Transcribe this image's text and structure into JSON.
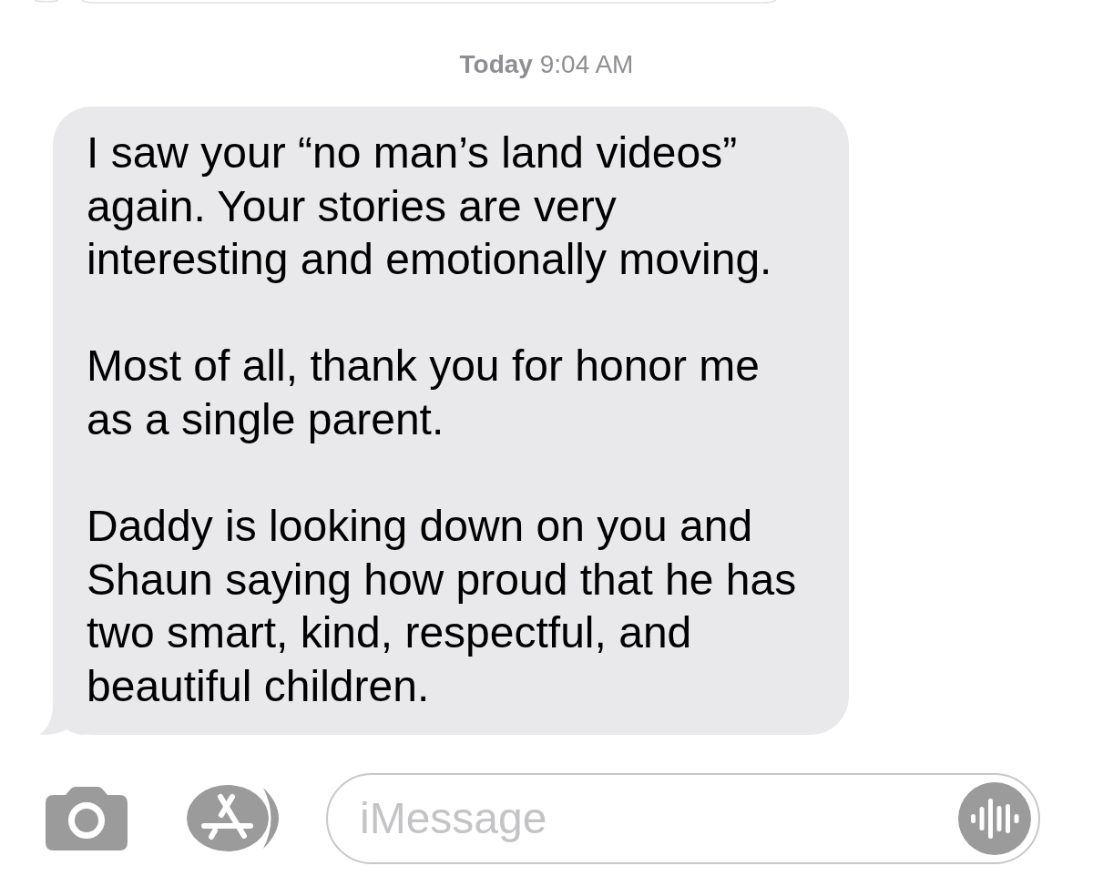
{
  "conversation": {
    "messages": [
      {
        "kind": "cut_off"
      },
      {
        "kind": "timestamp",
        "text": "**Today** 9:04 AM"
      },
      {
        "kind": "received",
        "paragraphs": [
          "I saw your “no man’s land videos” again. Your stories are very interesting and emotionally moving.",
          "Most of all, thank you for honor me as a single parent.",
          "Daddy is looking down on you and Shaun saying how proud that he has two smart, kind, respectful, and beautiful children."
        ]
      }
    ]
  },
  "compose_bar": {
    "placeholder": "iMessage"
  }
}
